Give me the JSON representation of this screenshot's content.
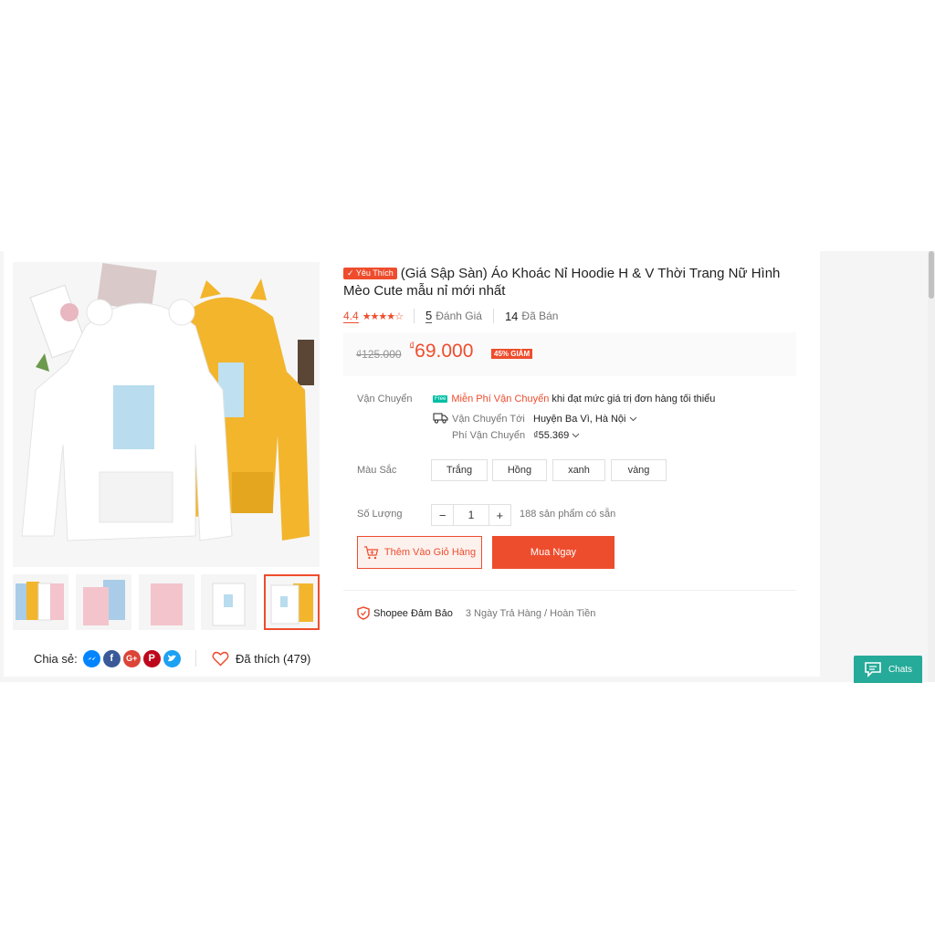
{
  "product": {
    "badge": "✓ Yêu Thích",
    "title": "(Giá Sập Sàn) Áo Khoác Nỉ Hoodie H & V Thời Trang Nữ Hình Mèo Cute mẫu nỉ mới nhất",
    "rating": "4.4",
    "rating_value": 4.4,
    "stars": "★★★★☆",
    "reviews_count": "5",
    "reviews_label": "Đánh Giá",
    "sold_count": "14",
    "sold_label": "Đã Bán"
  },
  "price": {
    "old": "₫125.000",
    "currency": "₫",
    "new": "69.000",
    "discount": "45% GIẢM"
  },
  "shipping": {
    "label": "Vận Chuyển",
    "free_tag": "Free",
    "free_text": "Miễn Phí Vận Chuyển",
    "free_condition": "khi đạt mức giá trị đơn hàng tối thiểu",
    "to_label": "Vận Chuyển Tới",
    "to_value": "Huyện Ba Vì, Hà Nội",
    "fee_label": "Phí Vận Chuyển",
    "fee_value": "₫55.369"
  },
  "color": {
    "label": "Màu Sắc",
    "options": [
      "Trắng",
      "Hồng",
      "xanh",
      "vàng"
    ]
  },
  "quantity": {
    "label": "Số Lượng",
    "minus": "−",
    "value": "1",
    "plus": "+",
    "stock": "188 sản phẩm có sẵn"
  },
  "actions": {
    "add_to_cart": "Thêm Vào Giỏ Hàng",
    "buy_now": "Mua Ngay"
  },
  "guarantee": {
    "title": "Shopee Đảm Bảo",
    "text": "3 Ngày Trả Hàng / Hoàn Tiền"
  },
  "share": {
    "label": "Chia sẻ:",
    "networks": [
      "messenger-icon",
      "facebook-icon",
      "google-plus-icon",
      "pinterest-icon",
      "twitter-icon"
    ]
  },
  "favorite": {
    "text": "Đã thích (479)"
  },
  "chat": {
    "label": "Chats"
  },
  "colors": {
    "accent": "#ee4d2d",
    "chat": "#26aa99"
  }
}
